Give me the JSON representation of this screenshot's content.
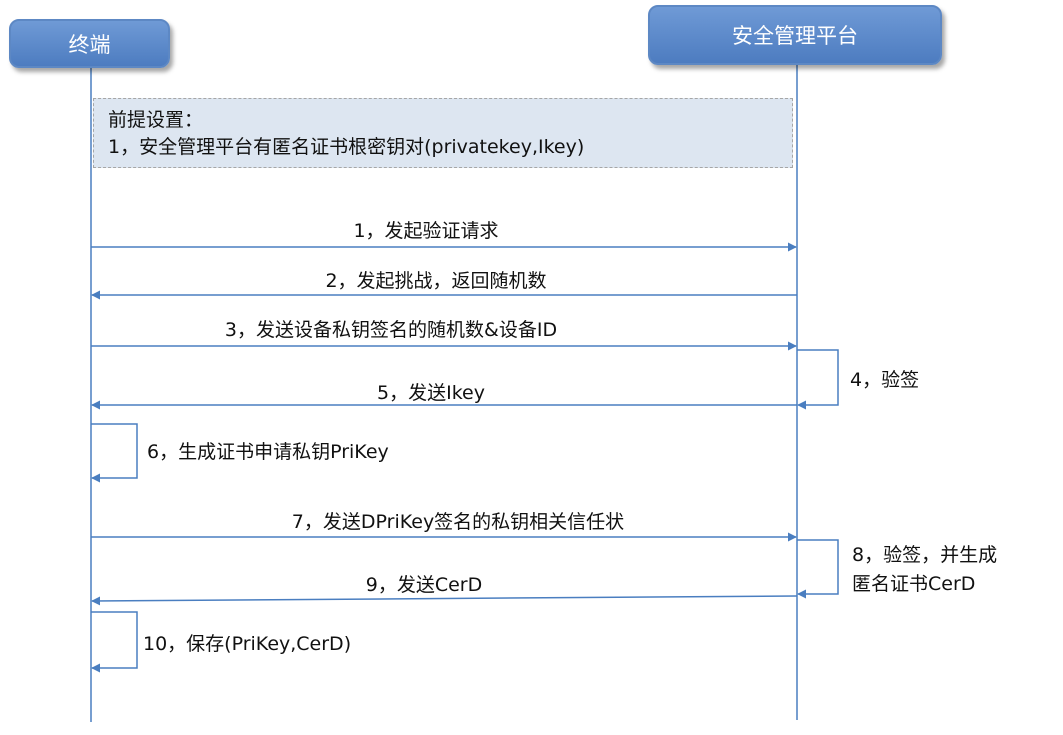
{
  "actors": {
    "terminal": "终端",
    "platform": "安全管理平台"
  },
  "premise": {
    "title": "前提设置：",
    "line1": "1，安全管理平台有匿名证书根密钥对(privatekey,Ikey)"
  },
  "messages": [
    "1，发起验证请求",
    "2，发起挑战，返回随机数",
    "3，发送设备私钥签名的随机数&设备ID",
    "4，验签",
    "5，发送Ikey",
    "6，生成证书申请私钥PriKey",
    "7，发送DPriKey签名的私钥相关信任状",
    "8，验签，并生成",
    "匿名证书CerD",
    "9，发送CerD",
    "10，保存(PriKey,CerD)"
  ],
  "colors": {
    "line": "#4a7ec0",
    "actor_fill": "#5b8bd0",
    "premise_fill": "#dde6f1"
  }
}
